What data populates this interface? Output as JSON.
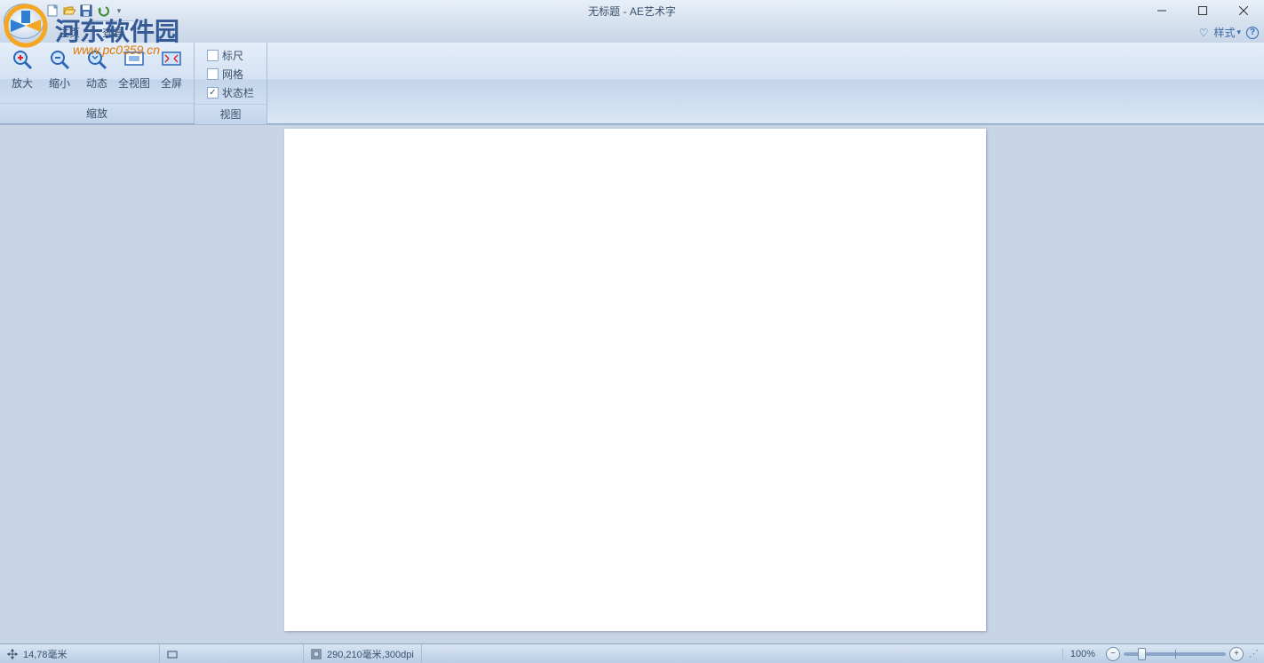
{
  "title": "无标题 - AE艺术字",
  "watermark": {
    "line1": "河东软件园",
    "line2": "www.pc0359.cn"
  },
  "tabs": {
    "home": "主页",
    "view": "查看"
  },
  "tabs_right": {
    "style": "样式"
  },
  "ribbon": {
    "zoom_group": "缩放",
    "view_group": "视图",
    "btn_zoom_in": "放大",
    "btn_zoom_out": "缩小",
    "btn_dynamic": "动态",
    "btn_fit": "全视图",
    "btn_fullscreen": "全屏",
    "chk_ruler": "标尺",
    "chk_grid": "网格",
    "chk_statusbar": "状态栏"
  },
  "status": {
    "cursor": "14,78毫米",
    "page": "290,210毫米,300dpi",
    "zoom_pct": "100%"
  }
}
